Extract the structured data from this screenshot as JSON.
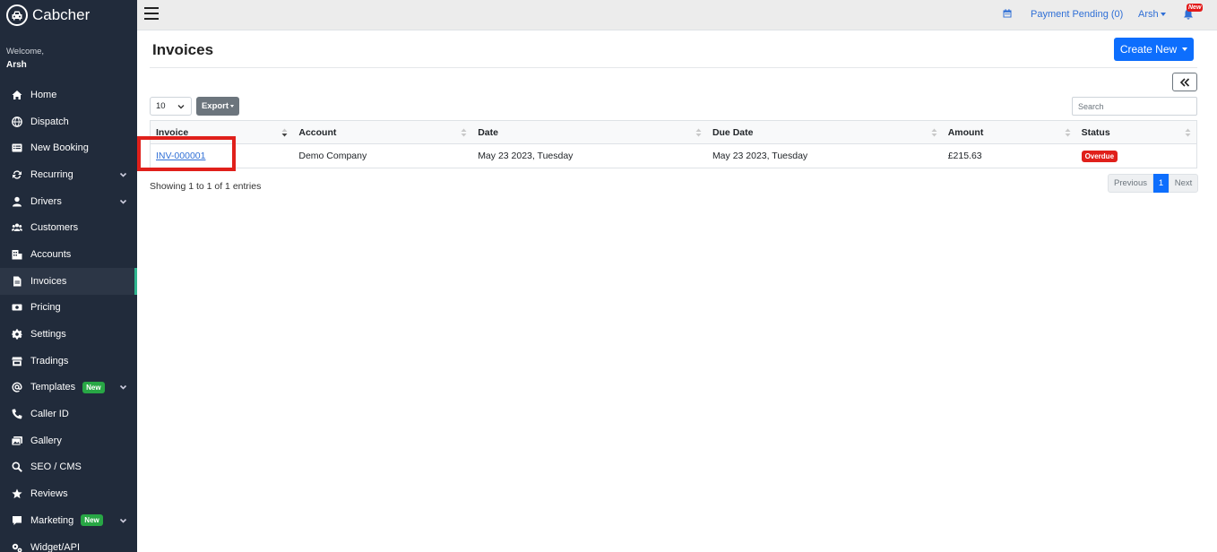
{
  "brand": {
    "name": "Cabcher"
  },
  "welcome": {
    "label": "Welcome,",
    "name": "Arsh"
  },
  "sidebar": {
    "items": [
      {
        "label": "Home",
        "icon": "home-icon"
      },
      {
        "label": "Dispatch",
        "icon": "globe-icon"
      },
      {
        "label": "New Booking",
        "icon": "list-icon"
      },
      {
        "label": "Recurring",
        "icon": "repeat-icon",
        "has_submenu": true
      },
      {
        "label": "Drivers",
        "icon": "user-icon",
        "has_submenu": true
      },
      {
        "label": "Customers",
        "icon": "users-icon"
      },
      {
        "label": "Accounts",
        "icon": "building-icon"
      },
      {
        "label": "Invoices",
        "icon": "file-icon",
        "active": true
      },
      {
        "label": "Pricing",
        "icon": "money-icon"
      },
      {
        "label": "Settings",
        "icon": "gear-icon"
      },
      {
        "label": "Tradings",
        "icon": "store-icon"
      },
      {
        "label": "Templates",
        "icon": "at-icon",
        "badge": "New",
        "has_submenu": true
      },
      {
        "label": "Caller ID",
        "icon": "phone-icon"
      },
      {
        "label": "Gallery",
        "icon": "images-icon"
      },
      {
        "label": "SEO / CMS",
        "icon": "search-icon"
      },
      {
        "label": "Reviews",
        "icon": "star-icon"
      },
      {
        "label": "Marketing",
        "icon": "comment-icon",
        "badge": "New",
        "has_submenu": true
      },
      {
        "label": "Widget/API",
        "icon": "cogs-icon"
      }
    ],
    "active_color": "#2fb58f",
    "badge_color": "#28a745"
  },
  "topbar": {
    "payment_pending": "Payment Pending (0)",
    "user": "Arsh",
    "notification_badge": "New",
    "link_color": "#2f6fd6"
  },
  "page": {
    "title": "Invoices",
    "create_new": "Create New",
    "page_size": "10",
    "export_label": "Export",
    "search_placeholder": "Search"
  },
  "table": {
    "columns": [
      "Invoice",
      "Account",
      "Date",
      "Due Date",
      "Amount",
      "Status"
    ],
    "rows": [
      {
        "invoice": "INV-000001",
        "account": "Demo Company",
        "date": "May 23 2023, Tuesday",
        "due_date": "May 23 2023, Tuesday",
        "amount": "£215.63",
        "status": "Overdue"
      }
    ]
  },
  "footer": {
    "showing": "Showing 1 to 1 of 1 entries",
    "previous": "Previous",
    "current_page": "1",
    "next": "Next"
  },
  "colors": {
    "sidebar_bg": "#212b3b",
    "primary": "#0d6efd",
    "danger": "#e0201b"
  }
}
